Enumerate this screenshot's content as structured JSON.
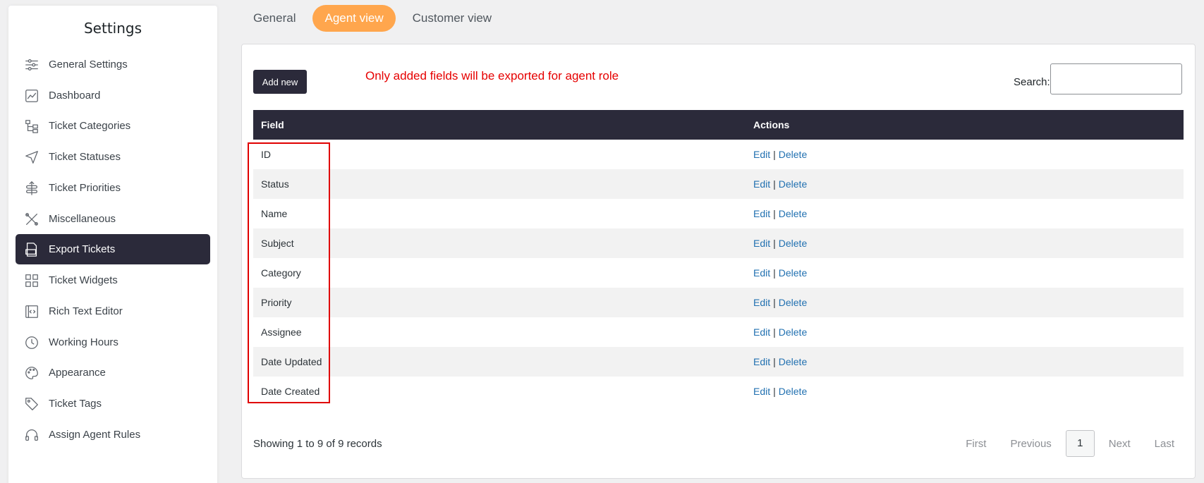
{
  "sidebar": {
    "title": "Settings",
    "items": [
      {
        "label": "General Settings",
        "icon": "sliders-icon",
        "active": false
      },
      {
        "label": "Dashboard",
        "icon": "chart-icon",
        "active": false
      },
      {
        "label": "Ticket Categories",
        "icon": "hierarchy-icon",
        "active": false
      },
      {
        "label": "Ticket Statuses",
        "icon": "send-icon",
        "active": false
      },
      {
        "label": "Ticket Priorities",
        "icon": "priority-icon",
        "active": false
      },
      {
        "label": "Miscellaneous",
        "icon": "tools-icon",
        "active": false
      },
      {
        "label": "Export Tickets",
        "icon": "csv-file-icon",
        "active": true
      },
      {
        "label": "Ticket Widgets",
        "icon": "widgets-icon",
        "active": false
      },
      {
        "label": "Rich Text Editor",
        "icon": "code-editor-icon",
        "active": false
      },
      {
        "label": "Working Hours",
        "icon": "clock-icon",
        "active": false
      },
      {
        "label": "Appearance",
        "icon": "palette-icon",
        "active": false
      },
      {
        "label": "Ticket Tags",
        "icon": "tag-icon",
        "active": false
      },
      {
        "label": "Assign Agent Rules",
        "icon": "headset-icon",
        "active": false
      }
    ]
  },
  "tabs": [
    {
      "label": "General",
      "active": false
    },
    {
      "label": "Agent view",
      "active": true
    },
    {
      "label": "Customer view",
      "active": false
    }
  ],
  "panel": {
    "add_new_label": "Add new",
    "notice": "Only added fields will be exported for agent role",
    "search_label": "Search:",
    "search_value": "",
    "columns": {
      "field": "Field",
      "actions": "Actions"
    },
    "rows": [
      {
        "field": "ID"
      },
      {
        "field": "Status"
      },
      {
        "field": "Name"
      },
      {
        "field": "Subject"
      },
      {
        "field": "Category"
      },
      {
        "field": "Priority"
      },
      {
        "field": "Assignee"
      },
      {
        "field": "Date Updated"
      },
      {
        "field": "Date Created"
      }
    ],
    "edit_label": "Edit",
    "separator": "|",
    "delete_label": "Delete",
    "records_info": "Showing 1 to 9 of 9 records",
    "pagination": {
      "first": "First",
      "previous": "Previous",
      "current": "1",
      "next": "Next",
      "last": "Last"
    }
  },
  "colors": {
    "accent": "#ffa64d",
    "dark": "#2b2a3a",
    "link": "#2271b1",
    "notice": "#e60000"
  }
}
